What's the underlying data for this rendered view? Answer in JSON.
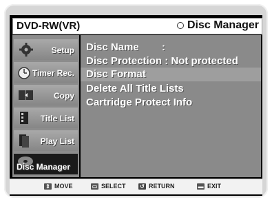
{
  "header": {
    "mode": "DVD-RW(VR)",
    "title": "Disc Manager",
    "title_icon": "ring-icon"
  },
  "sidebar": {
    "items": [
      {
        "label": "Setup",
        "icon": "gear-icon"
      },
      {
        "label": "Timer Rec.",
        "icon": "clock-icon"
      },
      {
        "label": "Copy",
        "icon": "copy-icon"
      },
      {
        "label": "Title List",
        "icon": "film-icon"
      },
      {
        "label": "Play List",
        "icon": "playlist-icon"
      },
      {
        "label": "Disc Manager",
        "icon": "disc-icon",
        "active": true
      }
    ]
  },
  "menu": {
    "items": [
      "Disc Name        :",
      "Disc Protection : Not protected",
      "Disc Format",
      "Delete All Title Lists",
      "Cartridge Protect Info"
    ],
    "selected_index": 2
  },
  "footer": {
    "move": "MOVE",
    "select": "SELECT",
    "return": "RETURN",
    "exit": "EXIT"
  },
  "colors": {
    "background": "#8a8a8a",
    "selected_row": "#9e9e9e",
    "text": "#ffffff"
  }
}
